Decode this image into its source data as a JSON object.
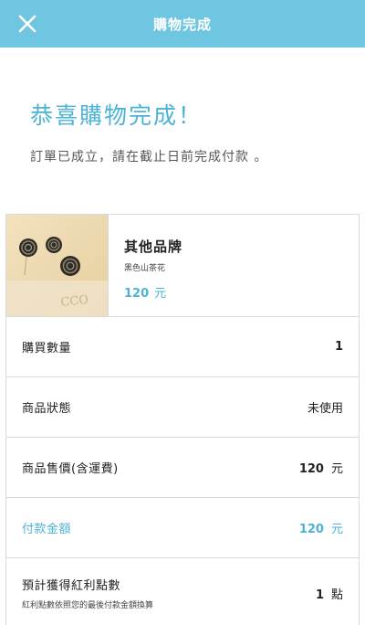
{
  "header": {
    "title": "購物完成",
    "close_icon": "close-icon"
  },
  "message": {
    "heading": "恭喜購物完成！",
    "note": "訂單已成立，請在截止日前完成付款 。"
  },
  "product": {
    "brand": "其他品牌",
    "name": "黑色山茶花",
    "price": "120",
    "price_unit": "元"
  },
  "details": {
    "quantity": {
      "label": "購買數量",
      "value": "1"
    },
    "status": {
      "label": "商品狀態",
      "value": "未使用"
    },
    "sale_price": {
      "label": "商品售價(含運費)",
      "value": "120",
      "unit": "元"
    },
    "payment": {
      "label": "付款金額",
      "value": "120",
      "unit": "元"
    },
    "points": {
      "label": "預計獲得紅利點數",
      "sub": "紅利點數依照您的最後付款金額換算",
      "value": "1",
      "unit": "點"
    }
  },
  "colors": {
    "header_bg": "#6fc6e0",
    "accent": "#4ab3d6"
  }
}
